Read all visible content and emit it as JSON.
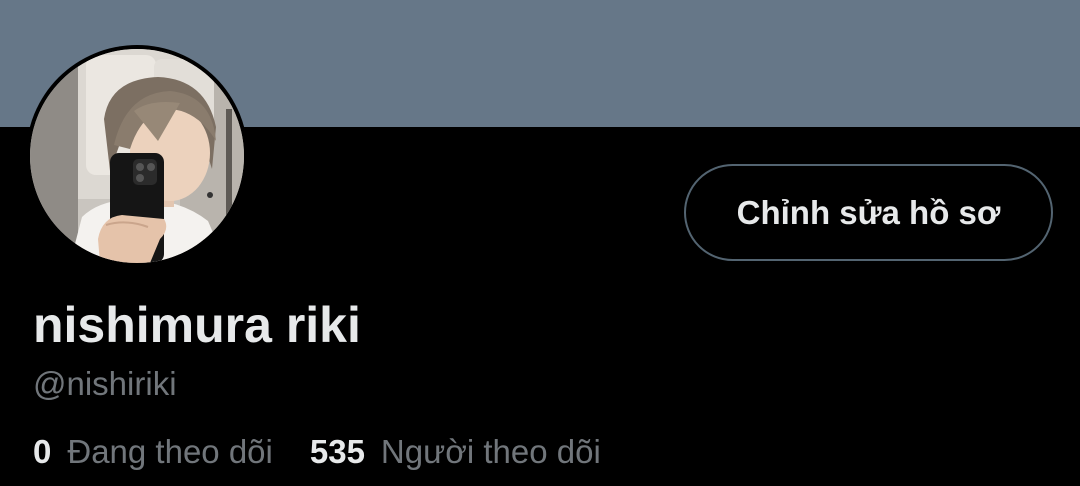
{
  "profile": {
    "display_name": "nishimura riki",
    "handle": "@nishiriki",
    "avatar_label": "profile-photo",
    "edit_button_label": "Chỉnh sửa hồ sơ"
  },
  "stats": {
    "following_count": "0",
    "following_label": "Đang theo dõi",
    "followers_count": "535",
    "followers_label": "Người theo dõi"
  },
  "colors": {
    "banner": "#667788",
    "background": "#000000",
    "primary_text": "#e7e9ea",
    "secondary_text": "#71767b",
    "button_border": "#536471"
  }
}
